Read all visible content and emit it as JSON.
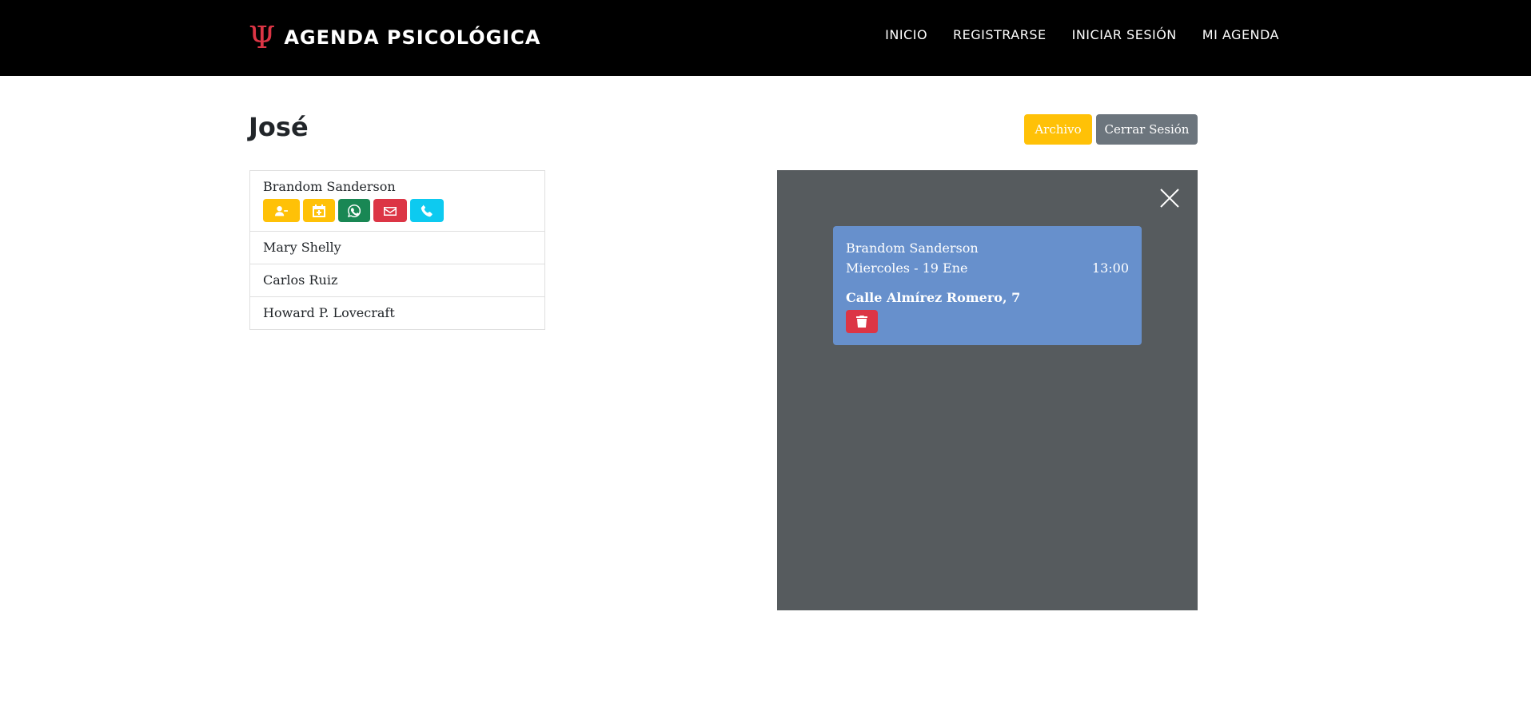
{
  "nav": {
    "brand": "AGENDA PSICOLÓGICA",
    "brand_icon": "Ψ",
    "links": [
      "INICIO",
      "REGISTRARSE",
      "INICIAR SESIÓN",
      "MI AGENDA"
    ]
  },
  "header": {
    "title": "José",
    "archive_label": "Archivo",
    "logout_label": "Cerrar Sesión"
  },
  "patients": [
    {
      "name": "Brandom Sanderson"
    },
    {
      "name": "Mary Shelly"
    },
    {
      "name": "Carlos Ruiz"
    },
    {
      "name": "Howard P. Lovecraft"
    }
  ],
  "appointment": {
    "patient": "Brandom Sanderson",
    "date": "Miercoles - 19 Ene",
    "time": "13:00",
    "address": "Calle Almírez Romero, 7"
  },
  "colors": {
    "accent_red": "#dc3545",
    "warning": "#ffc107",
    "success": "#198754",
    "info": "#0dcaf0",
    "secondary": "#6c757d",
    "panel_bg": "#565b5e",
    "card_bg": "#6790cc"
  },
  "icons": [
    "psi-logo-icon",
    "user-minus-icon",
    "calendar-plus-icon",
    "whatsapp-icon",
    "envelope-icon",
    "phone-icon",
    "close-icon",
    "trash-icon"
  ]
}
